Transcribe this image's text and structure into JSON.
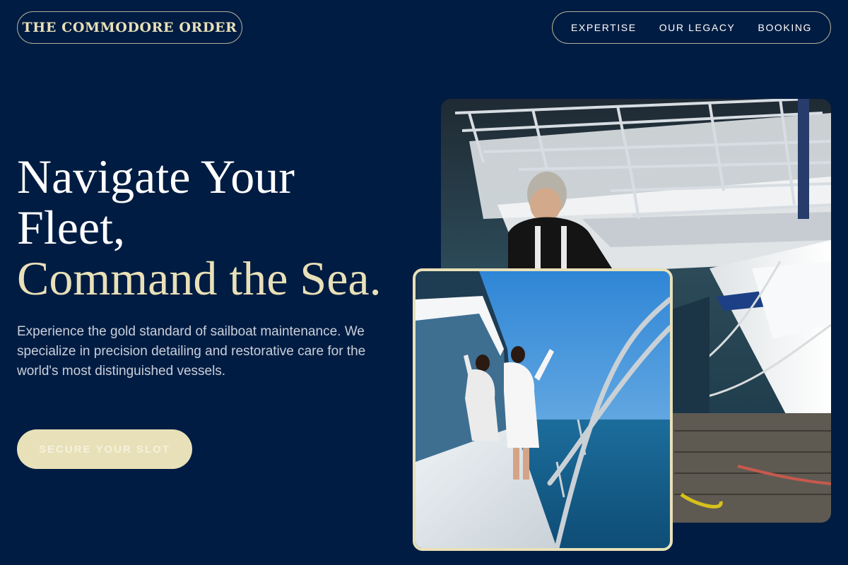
{
  "brand": {
    "logo": "THE COMMODORE ORDER"
  },
  "nav": {
    "items": [
      "EXPERTISE",
      "OUR LEGACY",
      "BOOKING"
    ]
  },
  "hero": {
    "title_line1": "Navigate Your",
    "title_line2": "Fleet,",
    "title_accent": "Command the Sea.",
    "description": "Experience the gold standard of sailboat maintenance. We specialize in precision detailing and restorative care for the world's most distinguished vessels.",
    "cta": "SECURE YOUR SLOT"
  },
  "colors": {
    "background": "#011c42",
    "accent": "#e8e0b8",
    "text": "#ffffff"
  }
}
